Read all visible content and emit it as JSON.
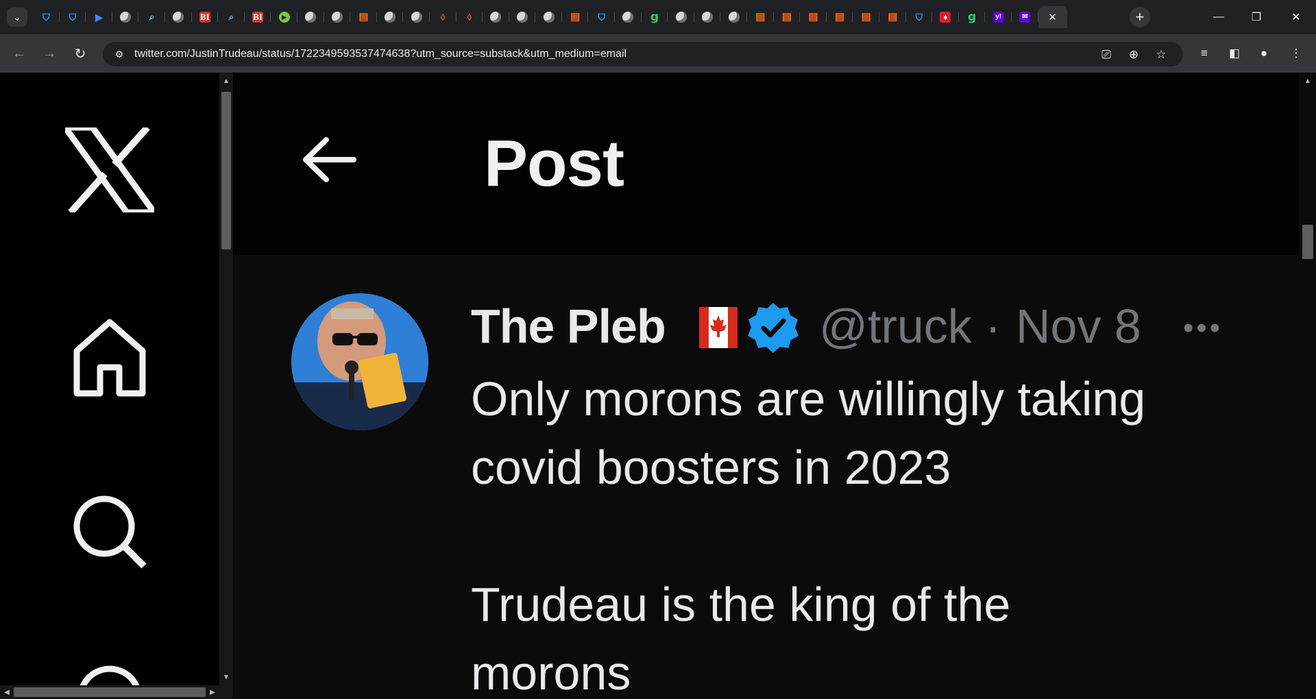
{
  "browser": {
    "tab_favicons": [
      "shield",
      "shield",
      "flag",
      "globe",
      "search",
      "globe",
      "BI",
      "search",
      "BI",
      "play",
      "globe",
      "globe",
      "substack",
      "globe",
      "globe",
      "brave",
      "brave",
      "globe",
      "globe",
      "globe",
      "substack",
      "shield",
      "globe",
      "g",
      "globe",
      "globe",
      "globe",
      "substack",
      "substack",
      "substack",
      "substack",
      "substack",
      "substack",
      "shield",
      "red",
      "g",
      "yahoo",
      "mail"
    ],
    "bi_text": "BI",
    "g_text": "g",
    "yahoo_text": "y!",
    "url": "twitter.com/JustinTrudeau/status/1722349593537474638?utm_source=substack&utm_medium=email",
    "colors": {
      "tab_strip": "#202124",
      "toolbar": "#35363a",
      "omnibox": "#202124"
    }
  },
  "page": {
    "header_title": "Post"
  },
  "tweet": {
    "display_name": "The Pleb",
    "handle": "@truck",
    "separator": "·",
    "date": "Nov 8",
    "more": "•••",
    "text_lines": [
      "Only morons are willingly taking",
      "covid boosters in 2023",
      "Trudeau is the king of the",
      "morons"
    ],
    "colors": {
      "verified": "#1d9bf0",
      "name": "#e7e9ea",
      "secondary": "#71767b"
    }
  }
}
